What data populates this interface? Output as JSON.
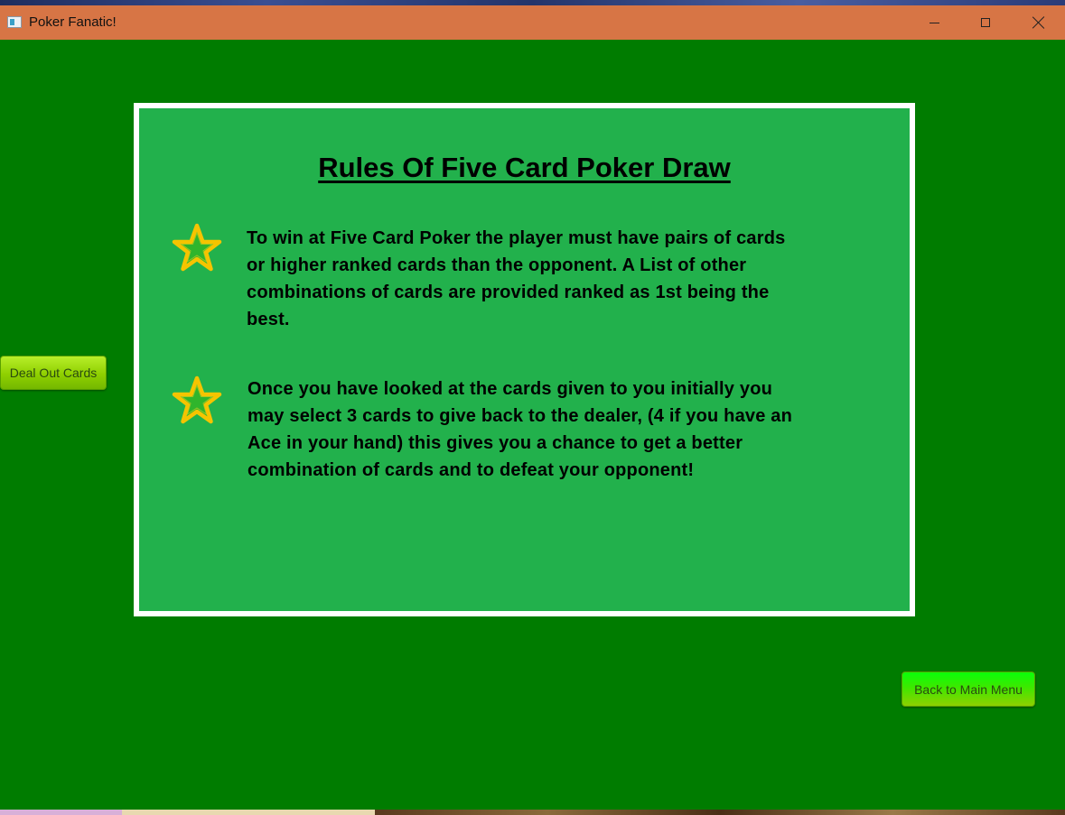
{
  "window": {
    "title": "Poker Fanatic!"
  },
  "rules": {
    "title": "Rules Of Five Card Poker Draw",
    "items": [
      {
        "text": "To win at Five Card Poker the player must have pairs of cards or higher ranked cards than the opponent. A List of other combinations of cards are provided ranked as 1st being the best."
      },
      {
        "text": "Once you have looked at the cards given to you initially you may select 3 cards to give back to the dealer, (4 if you have an Ace in your hand) this gives you a chance to get a better combination of cards and to defeat your opponent!"
      }
    ],
    "bullet_icon": "star-icon"
  },
  "buttons": {
    "deal_label": "Deal Out Cards",
    "back_label": "Back to Main Menu"
  },
  "colors": {
    "titlebar": "#d77545",
    "background": "#007c00",
    "panel": "#22b14c",
    "panel_border": "#ffffff",
    "star_outline": "#f5c400"
  }
}
